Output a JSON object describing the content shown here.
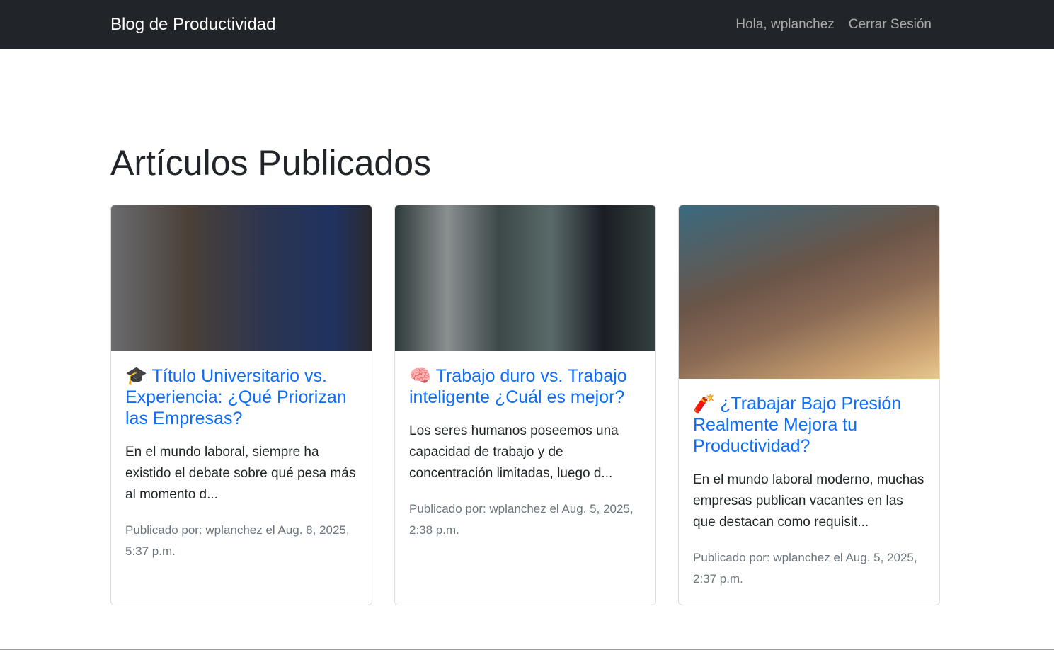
{
  "nav": {
    "brand": "Blog de Productividad",
    "greeting": "Hola, wplanchez",
    "logout": "Cerrar Sesión"
  },
  "page_title": "Artículos Publicados",
  "articles": [
    {
      "icon": "🎓",
      "title": "Título Universitario vs. Experiencia: ¿Qué Priorizan las Empresas?",
      "excerpt": "En el mundo laboral, siempre ha existido el debate sobre qué pesa más al momento d...",
      "meta": "Publicado por: wplanchez el Aug. 8, 2025, 5:37 p.m."
    },
    {
      "icon": "🧠",
      "title": "Trabajo duro vs. Trabajo inteligente ¿Cuál es mejor?",
      "excerpt": "Los seres humanos poseemos una capacidad de trabajo y de concentración limitadas, luego d...",
      "meta": "Publicado por: wplanchez el Aug. 5, 2025, 2:38 p.m."
    },
    {
      "icon": "🧨",
      "title": "¿Trabajar Bajo Presión Realmente Mejora tu Productividad?",
      "excerpt": "En el mundo laboral moderno, muchas empresas publican vacantes en las que destacan como requisit...",
      "meta": "Publicado por: wplanchez el Aug. 5, 2025, 2:37 p.m."
    }
  ]
}
